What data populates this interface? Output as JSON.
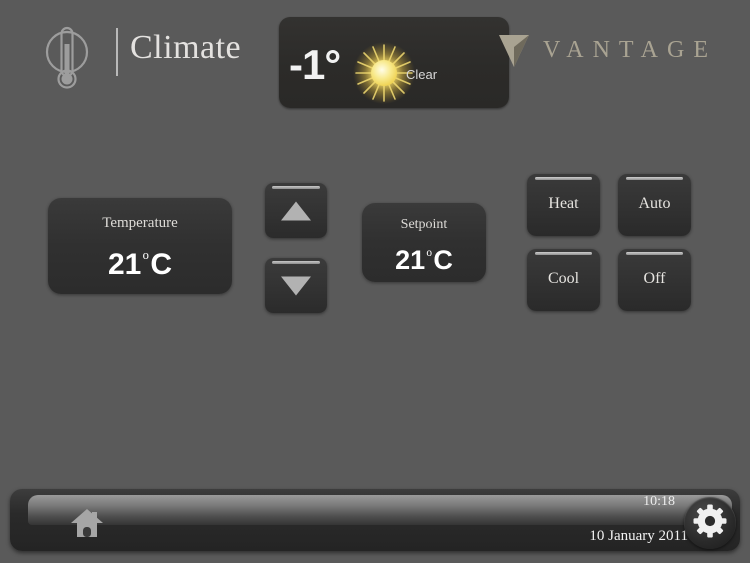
{
  "header": {
    "icon": "thermometer-icon",
    "title": "Climate",
    "weather": {
      "temperature": "-1°",
      "icon": "sun-icon",
      "condition": "Clear"
    },
    "brand": {
      "mark": "vantage-chevron-logo",
      "name": "VANTAGE",
      "color": "#a9a392"
    }
  },
  "controls": {
    "temperature": {
      "label": "Temperature",
      "value": "21",
      "degree": "o",
      "unit": "C"
    },
    "setpoint": {
      "label": "Setpoint",
      "value": "21",
      "degree": "o",
      "unit": "C"
    },
    "stepper": {
      "up_icon": "triangle-up-icon",
      "down_icon": "triangle-down-icon"
    },
    "modes": [
      {
        "label": "Heat"
      },
      {
        "label": "Auto"
      },
      {
        "label": "Cool"
      },
      {
        "label": "Off"
      }
    ]
  },
  "statusbar": {
    "home_icon": "home-icon",
    "time": "10:18",
    "date": "10 January 2011",
    "settings_icon": "gear-icon"
  },
  "colors": {
    "background": "#5a5a5a",
    "panel": "#333333",
    "brand": "#a9a392",
    "sun": "#f5e27a"
  }
}
